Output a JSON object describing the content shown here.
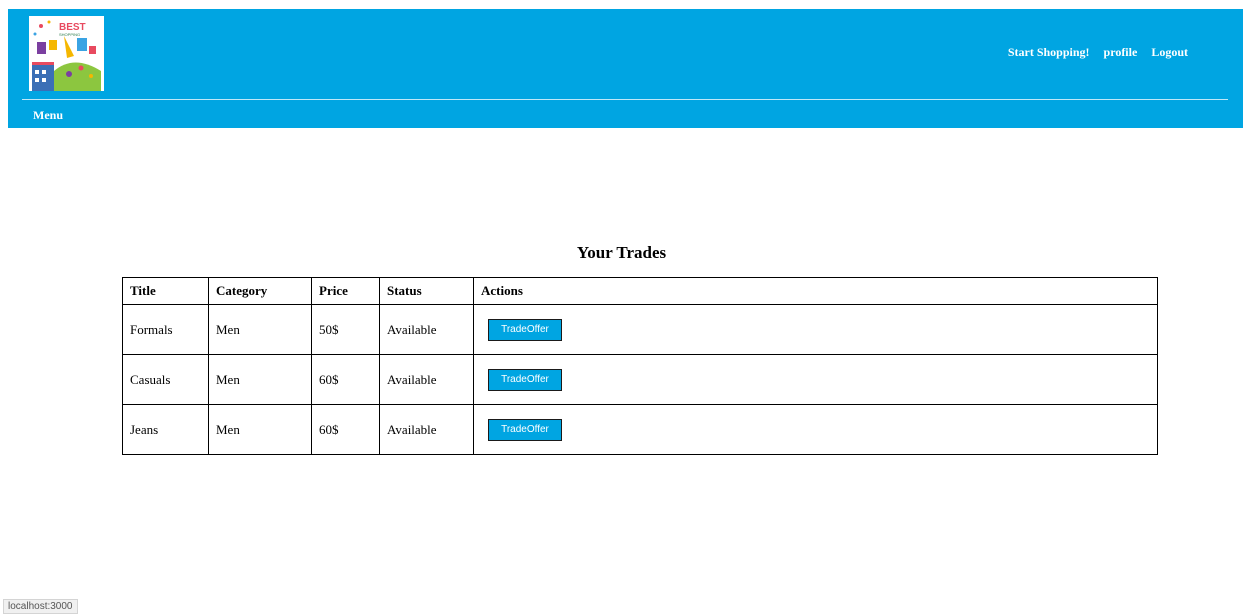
{
  "brand": {
    "logo_text": "BEST SHOPPING"
  },
  "nav": {
    "links": [
      "Start Shopping!",
      "profile",
      "Logout"
    ],
    "menu_label": "Menu"
  },
  "main": {
    "title": "Your Trades",
    "table": {
      "headers": [
        "Title",
        "Category",
        "Price",
        "Status",
        "Actions"
      ],
      "rows": [
        {
          "title": "Formals",
          "category": "Men",
          "price": "50$",
          "status": "Available",
          "action": "TradeOffer"
        },
        {
          "title": "Casuals",
          "category": "Men",
          "price": "60$",
          "status": "Available",
          "action": "TradeOffer"
        },
        {
          "title": "Jeans",
          "category": "Men",
          "price": "60$",
          "status": "Available",
          "action": "TradeOffer"
        }
      ]
    }
  },
  "status_bar": {
    "url": "localhost:3000"
  },
  "colors": {
    "accent": "#00a5e2",
    "text": "#000000",
    "background": "#ffffff"
  }
}
